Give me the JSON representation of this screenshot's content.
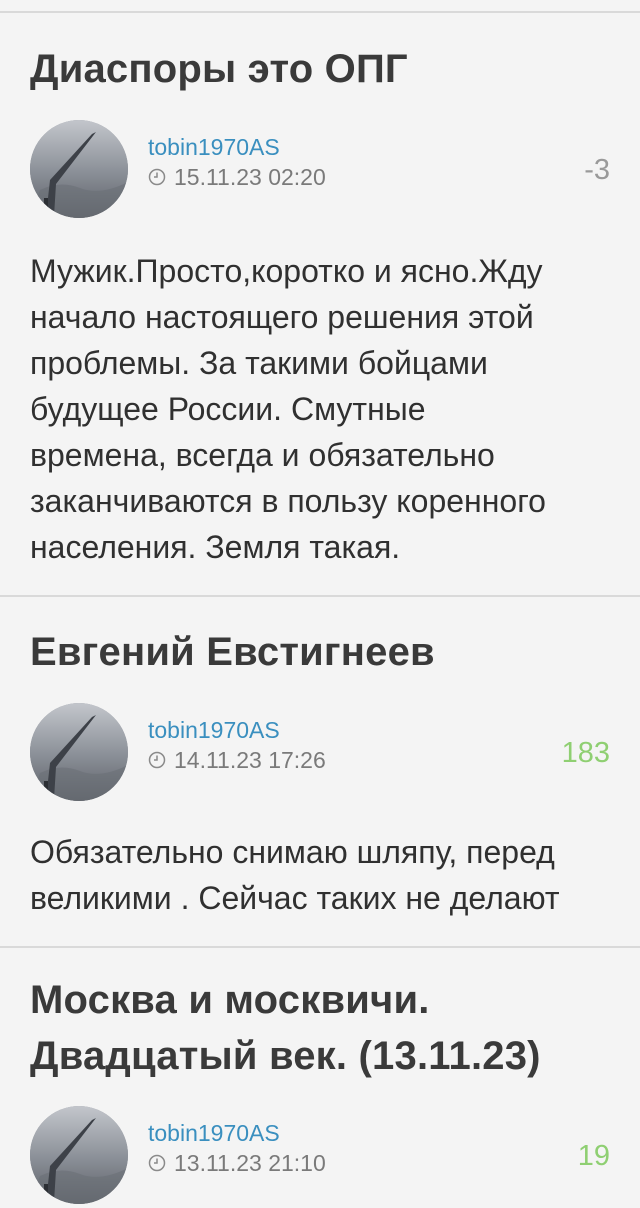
{
  "posts": [
    {
      "title_lines": [
        "Диаспоры это ОПГ"
      ],
      "author": "tobin1970AS",
      "date": "15.11.23 02:20",
      "score": "-3",
      "score_kind": "negative",
      "body_lines": [
        "Мужик.Просто,коротко и ясно.Жду",
        "начало настоящего решения этой",
        "проблемы. За такими бойцами",
        "будущее России. Смутные",
        "времена, всегда и обязательно",
        "заканчиваются в пользу коренного",
        "населения. Земля такая."
      ]
    },
    {
      "title_lines": [
        "Евгений Евстигнеев"
      ],
      "author": "tobin1970AS",
      "date": "14.11.23 17:26",
      "score": "183",
      "score_kind": "positive",
      "body_lines": [
        "Обязательно снимаю шляпу, перед",
        "великими . Сейчас таких не делают"
      ]
    },
    {
      "title_lines": [
        "Москва и москвичи.",
        "Двадцатый век. (13.11.23)"
      ],
      "author": "tobin1970AS",
      "date": "13.11.23 21:10",
      "score": "19",
      "score_kind": "positive",
      "body_lines": []
    }
  ],
  "icons": {
    "clock": "clock-icon",
    "avatar": "avatar-image"
  },
  "colors": {
    "author": "#3a8fbf",
    "score_positive": "#8fcf72",
    "score_negative": "#9a9a9a",
    "date": "#7a7a7a",
    "background": "#f4f4f4"
  }
}
